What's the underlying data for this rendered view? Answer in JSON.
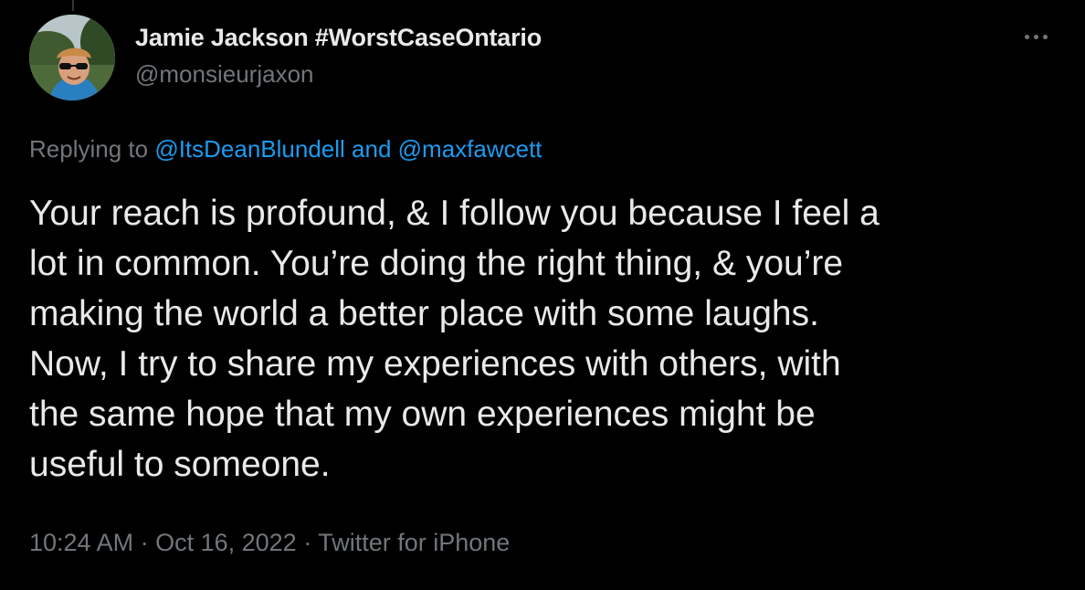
{
  "author": {
    "display_name": "Jamie Jackson #WorstCaseOntario",
    "handle": "@monsieurjaxon",
    "avatar_icon": "profile-photo"
  },
  "menu": {
    "icon": "more-horizontal-icon"
  },
  "reply_context": {
    "prefix": "Replying to ",
    "mention_1": "@ItsDeanBlundell",
    "connector": " and ",
    "mention_2": "@maxfawcett"
  },
  "tweet": {
    "lines": [
      "Your reach is profound, & I follow you because I feel a",
      "lot in common. You’re doing the right thing, & you’re",
      "making the world a better place with some laughs.",
      "Now, I try to share my experiences with others, with",
      "the same hope that my own experiences might be",
      "useful to someone."
    ]
  },
  "meta": {
    "time": "10:24 AM",
    "separator_1": " · ",
    "date": "Oct 16, 2022",
    "separator_2": " · ",
    "source": "Twitter for iPhone"
  },
  "colors": {
    "background": "#000000",
    "text_primary": "#e7e9ea",
    "text_secondary": "#71767b",
    "link": "#1d9bf0"
  }
}
